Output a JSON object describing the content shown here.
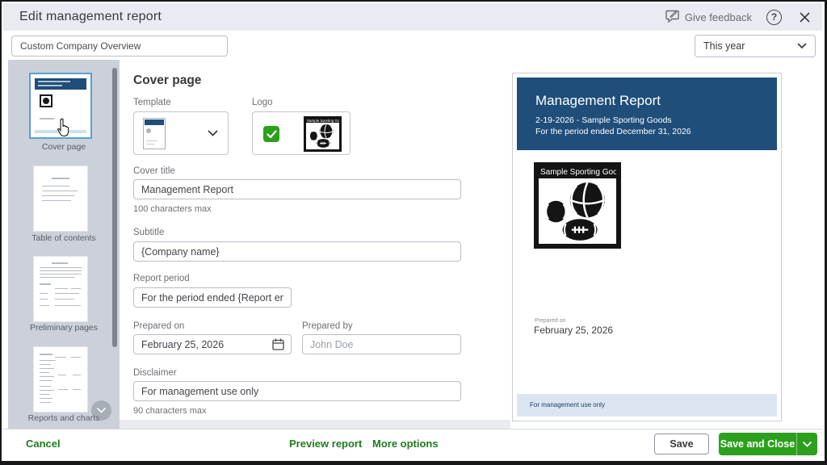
{
  "header": {
    "title": "Edit management report",
    "give_feedback_label": "Give feedback",
    "help_glyph": "?"
  },
  "toolbar": {
    "report_name_value": "Custom Company Overview",
    "period_value": "This year"
  },
  "sidebar": {
    "items": [
      {
        "label": "Cover page",
        "selected": true
      },
      {
        "label": "Table of contents",
        "selected": false
      },
      {
        "label": "Preliminary pages",
        "selected": false
      },
      {
        "label": "Reports and charts",
        "selected": false
      }
    ]
  },
  "form": {
    "heading": "Cover page",
    "template_label": "Template",
    "logo_label": "Logo",
    "logo_checked": true,
    "cover_title": {
      "label": "Cover title",
      "value": "Management Report",
      "helper": "100 characters max"
    },
    "subtitle": {
      "label": "Subtitle",
      "value": "{Company name}"
    },
    "report_period": {
      "label": "Report period",
      "value": "For the period ended {Report end date}"
    },
    "prepared_on": {
      "label": "Prepared on",
      "value": "February 25, 2026"
    },
    "prepared_by": {
      "label": "Prepared by",
      "value": "John Doe"
    },
    "disclaimer": {
      "label": "Disclaimer",
      "value": "For management use only",
      "helper": "90 characters max"
    }
  },
  "preview": {
    "title": "Management Report",
    "subtitle_line1": "2-19-2026 - Sample Sporting Goods",
    "subtitle_line2": "For the period ended December 31, 2026",
    "logo_caption": "Sample Sporting Goods",
    "prepared_on_label": "Prepared on",
    "prepared_on_value": "February 25, 2026",
    "footer_text": "For management use only"
  },
  "footer": {
    "cancel": "Cancel",
    "preview_report": "Preview report",
    "more_options": "More options",
    "save": "Save",
    "save_and_close": "Save and Close"
  },
  "colors": {
    "accent_green": "#2ca01c",
    "link_green": "#1e7c1e",
    "preview_blue": "#1e4e79",
    "preview_footer_bg": "#dbe6f2",
    "header_bg": "#e9eaf2",
    "sidebar_bg": "#ccd1d9",
    "selection_blue": "#58a0d6"
  }
}
